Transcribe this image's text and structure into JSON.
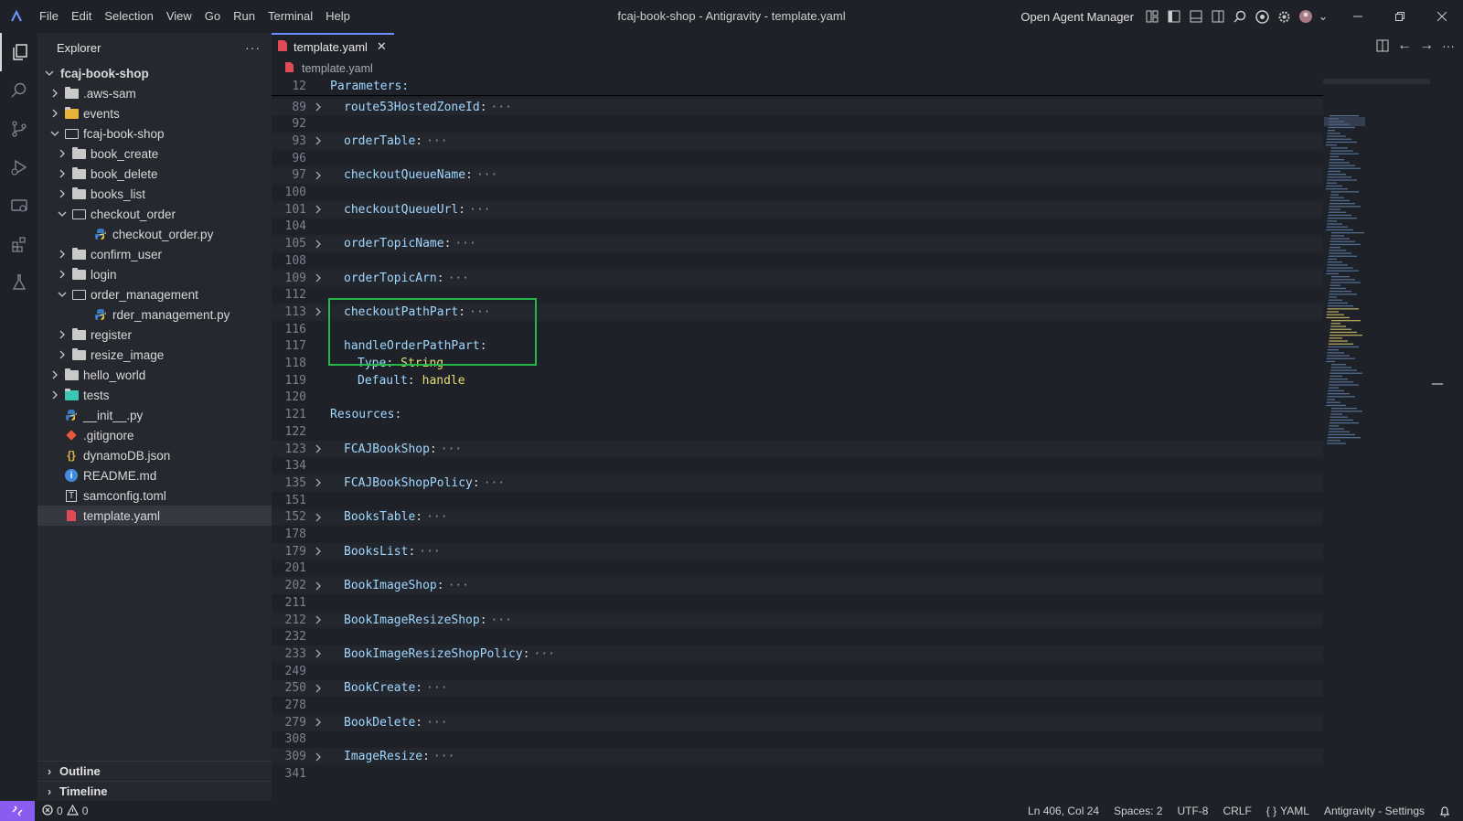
{
  "titlebar": {
    "menu": [
      "File",
      "Edit",
      "Selection",
      "View",
      "Go",
      "Run",
      "Terminal",
      "Help"
    ],
    "window_title": "fcaj-book-shop - Antigravity - template.yaml",
    "agent_manager": "Open Agent Manager"
  },
  "sidebar": {
    "title": "Explorer",
    "tree": [
      {
        "label": "fcaj-book-shop",
        "depth": 0,
        "kind": "root",
        "open": true
      },
      {
        "label": ".aws-sam",
        "depth": 1,
        "kind": "folder",
        "open": false
      },
      {
        "label": "events",
        "depth": 1,
        "kind": "folder-yellow",
        "open": false
      },
      {
        "label": "fcaj-book-shop",
        "depth": 1,
        "kind": "folder",
        "open": true
      },
      {
        "label": "book_create",
        "depth": 2,
        "kind": "folder",
        "open": false
      },
      {
        "label": "book_delete",
        "depth": 2,
        "kind": "folder",
        "open": false
      },
      {
        "label": "books_list",
        "depth": 2,
        "kind": "folder",
        "open": false
      },
      {
        "label": "checkout_order",
        "depth": 2,
        "kind": "folder",
        "open": true
      },
      {
        "label": "checkout_order.py",
        "depth": 3,
        "kind": "python"
      },
      {
        "label": "confirm_user",
        "depth": 2,
        "kind": "folder",
        "open": false
      },
      {
        "label": "login",
        "depth": 2,
        "kind": "folder",
        "open": false
      },
      {
        "label": "order_management",
        "depth": 2,
        "kind": "folder",
        "open": true
      },
      {
        "label": "rder_management.py",
        "depth": 3,
        "kind": "python"
      },
      {
        "label": "register",
        "depth": 2,
        "kind": "folder",
        "open": false
      },
      {
        "label": "resize_image",
        "depth": 2,
        "kind": "folder",
        "open": false
      },
      {
        "label": "hello_world",
        "depth": 1,
        "kind": "folder",
        "open": false
      },
      {
        "label": "tests",
        "depth": 1,
        "kind": "folder-teal",
        "open": false
      },
      {
        "label": "__init__.py",
        "depth": 1,
        "kind": "python-file"
      },
      {
        "label": ".gitignore",
        "depth": 1,
        "kind": "git"
      },
      {
        "label": "dynamoDB.json",
        "depth": 1,
        "kind": "json"
      },
      {
        "label": "README.md",
        "depth": 1,
        "kind": "info"
      },
      {
        "label": "samconfig.toml",
        "depth": 1,
        "kind": "toml"
      },
      {
        "label": "template.yaml",
        "depth": 1,
        "kind": "yaml",
        "selected": true
      }
    ],
    "panels": [
      "Outline",
      "Timeline"
    ]
  },
  "editor": {
    "tab": "template.yaml",
    "breadcrumb": "template.yaml",
    "sticky": {
      "num": "12",
      "text": "Parameters:"
    },
    "lines": [
      {
        "num": "89",
        "fold": true,
        "key": "route53HostedZoneId"
      },
      {
        "num": "92"
      },
      {
        "num": "93",
        "fold": true,
        "key": "orderTable"
      },
      {
        "num": "96"
      },
      {
        "num": "97",
        "fold": true,
        "key": "checkoutQueueName"
      },
      {
        "num": "100"
      },
      {
        "num": "101",
        "fold": true,
        "key": "checkoutQueueUrl"
      },
      {
        "num": "104"
      },
      {
        "num": "105",
        "fold": true,
        "key": "orderTopicName"
      },
      {
        "num": "108"
      },
      {
        "num": "109",
        "fold": true,
        "key": "orderTopicArn"
      },
      {
        "num": "112"
      },
      {
        "num": "113",
        "fold": true,
        "key": "checkoutPathPart"
      },
      {
        "num": "116"
      },
      {
        "num": "117",
        "key": "handleOrderPathPart",
        "plain": true
      },
      {
        "num": "118",
        "key": "Type",
        "value": "String",
        "indent": 2
      },
      {
        "num": "119",
        "key": "Default",
        "value": "handle",
        "indent": 2
      },
      {
        "num": "120"
      },
      {
        "num": "121",
        "key": "Resources",
        "plain": true,
        "indent": -2
      },
      {
        "num": "122"
      },
      {
        "num": "123",
        "fold": true,
        "key": "FCAJBookShop"
      },
      {
        "num": "134"
      },
      {
        "num": "135",
        "fold": true,
        "key": "FCAJBookShopPolicy"
      },
      {
        "num": "151"
      },
      {
        "num": "152",
        "fold": true,
        "key": "BooksTable"
      },
      {
        "num": "178"
      },
      {
        "num": "179",
        "fold": true,
        "key": "BooksList"
      },
      {
        "num": "201"
      },
      {
        "num": "202",
        "fold": true,
        "key": "BookImageShop"
      },
      {
        "num": "211"
      },
      {
        "num": "212",
        "fold": true,
        "key": "BookImageResizeShop"
      },
      {
        "num": "232"
      },
      {
        "num": "233",
        "fold": true,
        "key": "BookImageResizeShopPolicy"
      },
      {
        "num": "249"
      },
      {
        "num": "250",
        "fold": true,
        "key": "BookCreate"
      },
      {
        "num": "278"
      },
      {
        "num": "279",
        "fold": true,
        "key": "BookDelete"
      },
      {
        "num": "308"
      },
      {
        "num": "309",
        "fold": true,
        "key": "ImageResize"
      },
      {
        "num": "341"
      }
    ]
  },
  "statusbar": {
    "errors": "0",
    "warnings": "0",
    "position": "Ln 406, Col 24",
    "spaces": "Spaces: 2",
    "encoding": "UTF-8",
    "eol": "CRLF",
    "language": "YAML",
    "settings": "Antigravity - Settings"
  },
  "colors": {
    "accent": "#8a5cf0",
    "highlight_box": "#23b84a",
    "key": "#9fd7ff",
    "string": "#e6db74"
  }
}
